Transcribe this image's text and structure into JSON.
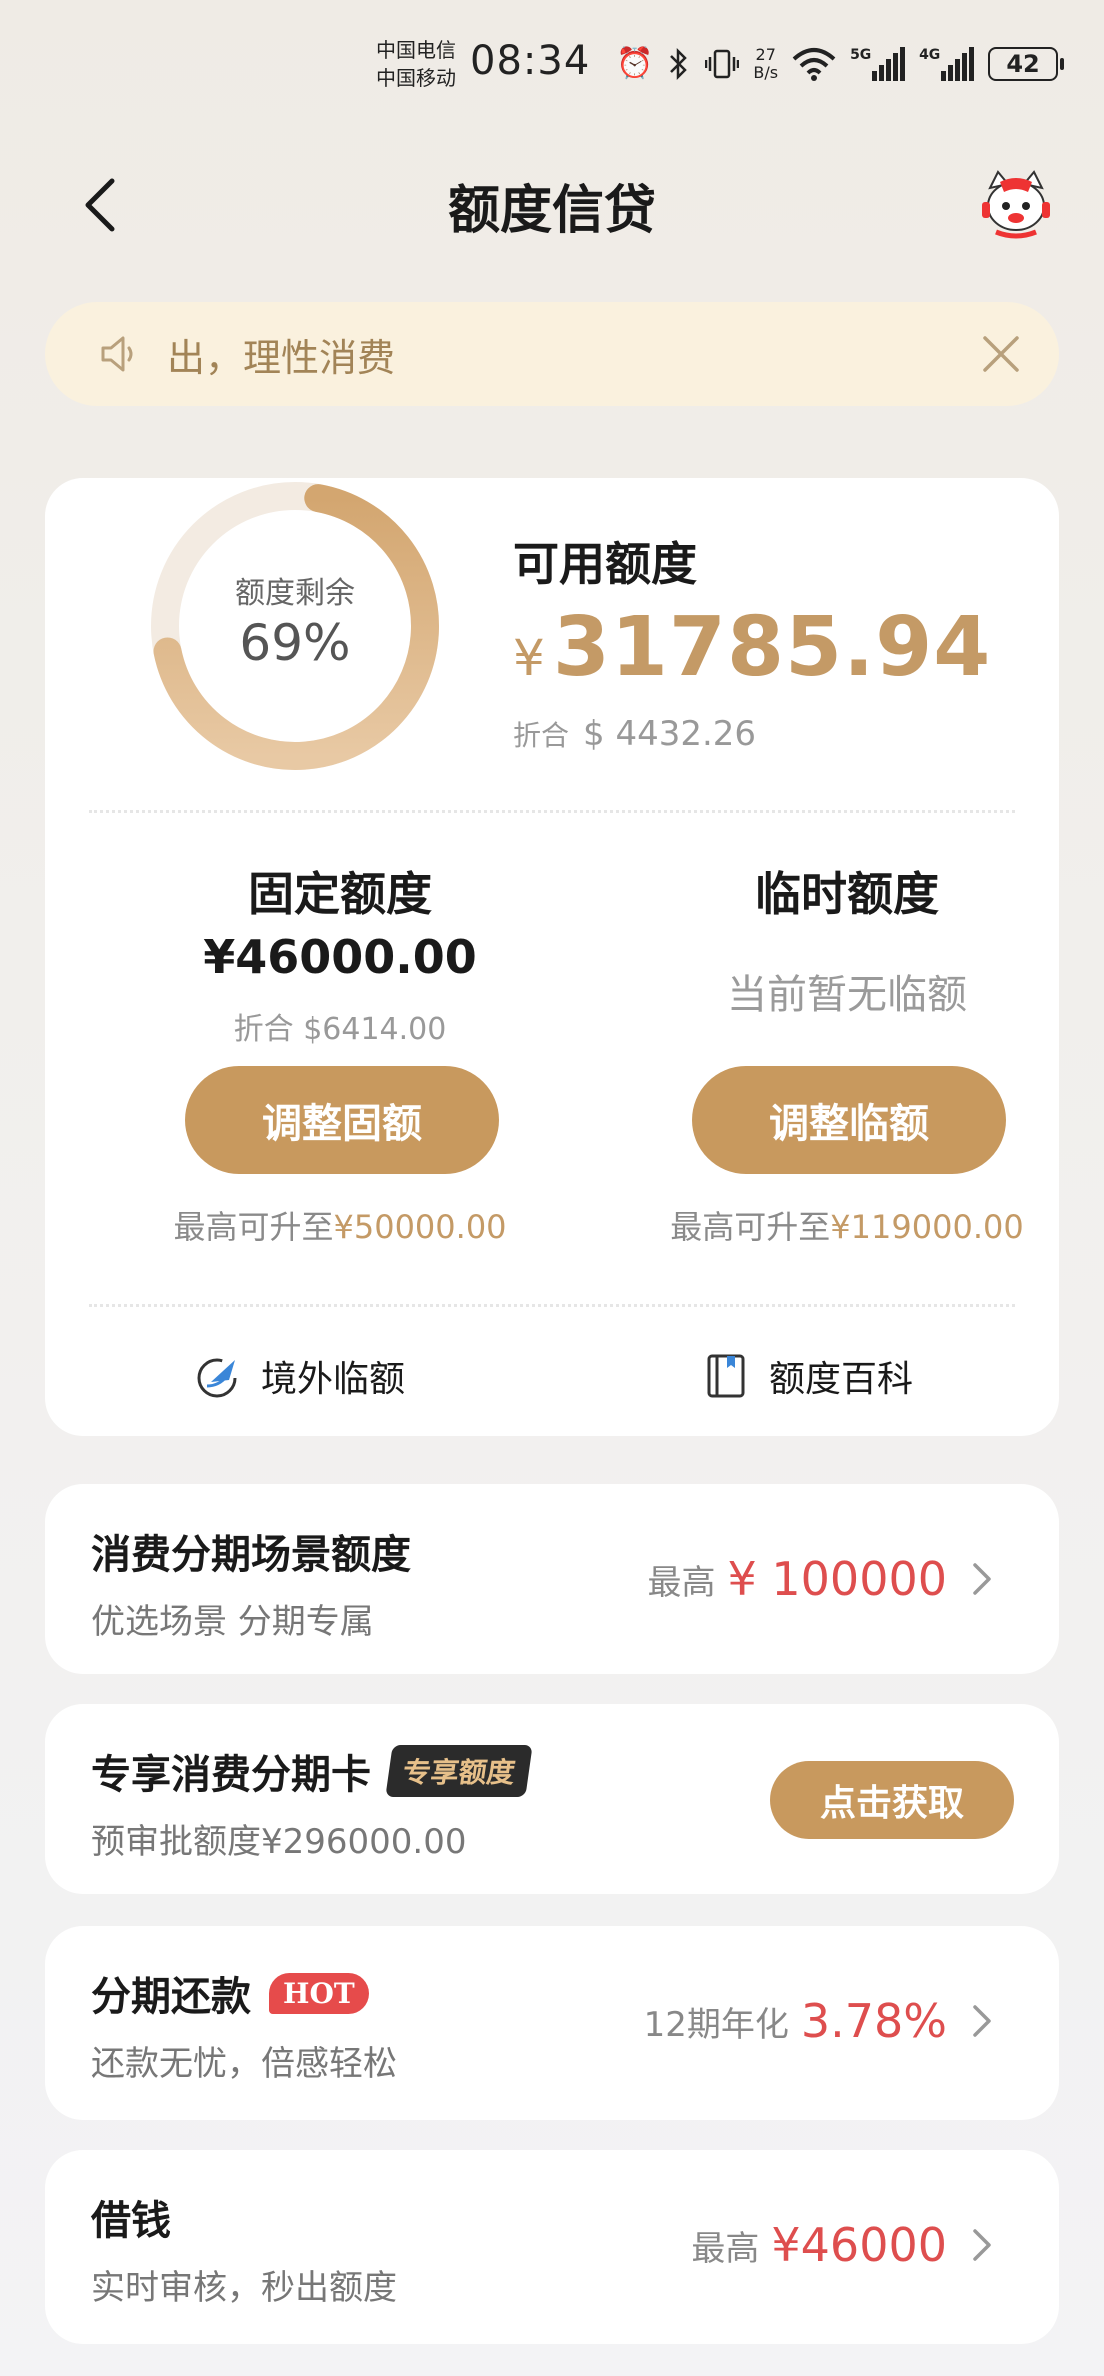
{
  "status_bar": {
    "carrier_1": "中国电信",
    "carrier_2": "中国移动",
    "time": "08:34",
    "speed_value": "27",
    "speed_unit": "B/s",
    "sig1_tag": "5G",
    "sig2_tag": "4G",
    "battery": "42"
  },
  "header": {
    "title": "额度信贷"
  },
  "notice": {
    "text": "出，理性消费"
  },
  "credit": {
    "ring_label": "额度剩余",
    "ring_percent": "69%",
    "ring_fraction": 0.69,
    "available_label": "可用额度",
    "available_currency": "¥",
    "available_amount": "31785.94",
    "available_usd_prefix": "折合",
    "available_usd": "$ 4432.26",
    "fixed": {
      "title": "固定额度",
      "amount": "¥46000.00",
      "usd": "折合 $6414.00",
      "button": "调整固额",
      "max_prefix": "最高可升至",
      "max_value": "¥50000.00"
    },
    "temp": {
      "title": "临时额度",
      "none_text": "当前暂无临额",
      "button": "调整临额",
      "max_prefix": "最高可升至",
      "max_value": "¥119000.00"
    },
    "shortcuts": {
      "overseas": "境外临额",
      "encyclopedia": "额度百科"
    }
  },
  "rows": {
    "installment_scene": {
      "title": "消费分期场景额度",
      "subtitle": "优选场景 分期专属",
      "prefix": "最高",
      "value": "¥ 100000"
    },
    "exclusive_card": {
      "title": "专享消费分期卡",
      "badge": "专享额度",
      "subtitle": "预审批额度¥296000.00",
      "button": "点击获取"
    },
    "installment_repay": {
      "title": "分期还款",
      "badge": "HOT",
      "subtitle": "还款无忧，倍感轻松",
      "prefix": "12期年化",
      "value": "3.78%"
    },
    "borrow": {
      "title": "借钱",
      "subtitle": "实时审核，秒出额度",
      "prefix": "最高",
      "value": "¥46000"
    }
  },
  "colors": {
    "accent_gold": "#c8995e",
    "highlight_red": "#de4e4e",
    "notice_bg": "#faf1de"
  }
}
